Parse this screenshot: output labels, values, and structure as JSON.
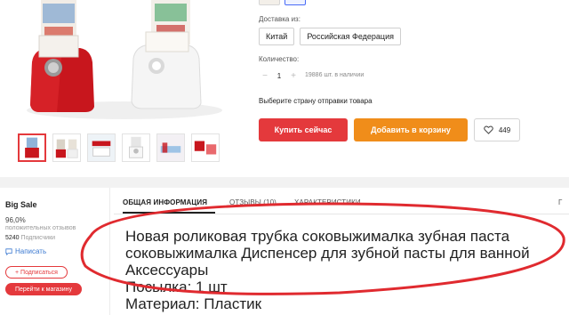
{
  "product_options": {
    "ship_from_label": "Доставка из:",
    "ship_from_options": [
      "Китай",
      "Российская Федерация"
    ],
    "quantity_label": "Количество:",
    "quantity_value": "1",
    "quantity_minus": "−",
    "quantity_plus": "+",
    "stock_text": "19886 шт. в наличии",
    "ship_note": "Выберите страну отправки товара"
  },
  "actions": {
    "buy_now": "Купить сейчас",
    "add_to_cart": "Добавить в корзину",
    "wishlist_count": "449"
  },
  "seller": {
    "name": "Big Sale",
    "rating_value": "96,0%",
    "rating_label": "положительных отзывов",
    "subscribers_count": "5240",
    "subscribers_label": "Подписчики",
    "message_label": "Написать",
    "follow_label": "+ Подписаться",
    "store_label": "Перейти к магазину"
  },
  "tabs": [
    "ОБЩАЯ ИНФОРМАЦИЯ",
    "ОТЗЫВЫ (10)",
    "ХАРАКТЕРИСТИКИ",
    "Г"
  ],
  "description": {
    "lines": [
      "Новая роликовая трубка соковыжималка зубная паста соковыжималка Диспенсер для зубной пасты для ванной Аксессуары",
      "Посылка: 1 шт",
      "Материал: Пластик"
    ]
  },
  "colors": {
    "accent_red": "#e4393c",
    "accent_orange": "#f08d1a",
    "link_blue": "#3b79d1"
  },
  "icons": [
    "heart-icon",
    "chat-icon",
    "toothpaste-squeezer-photo"
  ]
}
